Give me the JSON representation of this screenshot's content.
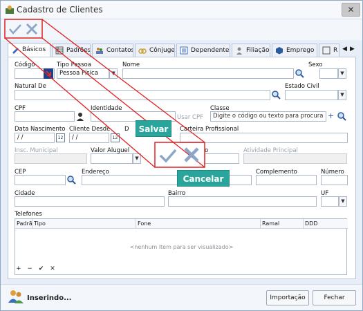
{
  "window": {
    "title": "Cadastro de Clientes",
    "close": "✕",
    "minimize": "─",
    "maximize": "☐"
  },
  "tabs": [
    {
      "label": "Básicos"
    },
    {
      "label": "Padrões"
    },
    {
      "label": "Contatos"
    },
    {
      "label": "Cônjuge"
    },
    {
      "label": "Dependentes"
    },
    {
      "label": "Filiação"
    },
    {
      "label": "Emprego"
    },
    {
      "label": "R"
    }
  ],
  "form": {
    "codigo_label": "Código",
    "tipo_pessoa_label": "Tipo Pessoa",
    "tipo_pessoa_value": "Pessoa Física",
    "nome_label": "Nome",
    "sexo_label": "Sexo",
    "natural_label": "Natural De",
    "estado_civil_label": "Estado Civil",
    "cpf_label": "CPF",
    "identidade_label": "Identidade",
    "usar_cpf_label": "Usar CPF",
    "classe_label": "Classe",
    "classe_placeholder": "Digite o código ou texto para procura",
    "data_nasc_label": "Data Nascimento",
    "data_nasc_value": " / /",
    "cliente_desde_label": "Cliente Desde",
    "cliente_desde_value": " / /",
    "d_label": "D",
    "carteira_label": "Carteira Profissional",
    "insc_label": "Insc. Municipal",
    "valor_aluguel_label": "Valor Aluguel",
    "o_label": "o",
    "atividade_label": "Atividade Principal",
    "cep_label": "CEP",
    "endereco_label": "Endereço",
    "complemento_label": "Complemento",
    "numero_label": "Número",
    "cidade_label": "Cidade",
    "bairro_label": "Bairro",
    "uf_label": "UF",
    "telefones_label": "Telefones"
  },
  "grid": {
    "columns": [
      "Padrã",
      "Tipo",
      "Fone",
      "Ramal",
      "DDD"
    ],
    "empty": "<nenhum item para ser visualizado>",
    "nav": "+ − ✔ ✕"
  },
  "status": {
    "text": "Inserindo..."
  },
  "buttons": {
    "importacao": "Importação",
    "fechar": "Fechar"
  },
  "callouts": {
    "salvar": "Salvar",
    "cancelar": "Cancelar"
  },
  "colors": {
    "callout": "#2aa59c",
    "highlight": "#e02020",
    "accent": "#2c5aa0"
  }
}
